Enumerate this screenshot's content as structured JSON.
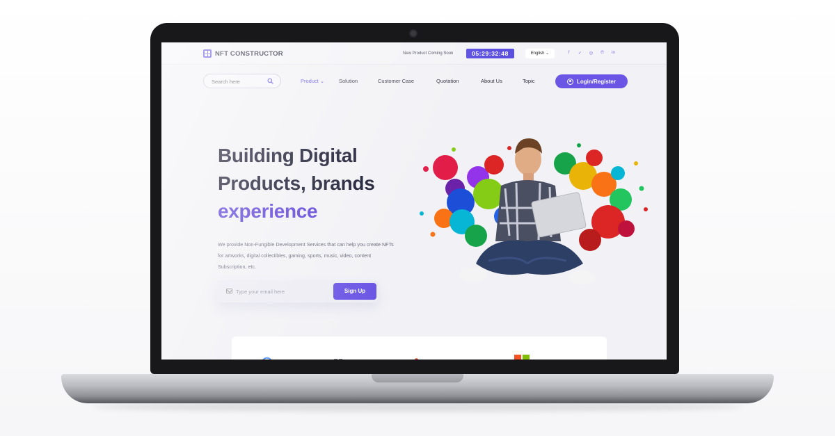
{
  "topbar": {
    "logo_text": "NFT CONSTRUCTOR",
    "coming_soon": "New Product Coming Soon",
    "countdown": "05:29:32:48",
    "language": "English ⌄",
    "social": [
      {
        "name": "facebook-icon",
        "glyph": "f"
      },
      {
        "name": "twitter-icon",
        "glyph": "✓"
      },
      {
        "name": "instagram-icon",
        "glyph": "◎"
      },
      {
        "name": "pinterest-icon",
        "glyph": "℗"
      },
      {
        "name": "linkedin-icon",
        "glyph": "in"
      }
    ]
  },
  "nav": {
    "search_placeholder": "Search here",
    "items": [
      {
        "label": "Product ⌄",
        "active": true
      },
      {
        "label": "Solution"
      },
      {
        "label": "Customer Case"
      },
      {
        "label": "Quotation"
      },
      {
        "label": "About Us"
      },
      {
        "label": "Topic"
      }
    ],
    "login_label": "Login/Register"
  },
  "hero": {
    "title_line1": "Building Digital",
    "title_line2": "Products, brands",
    "title_accent": "experience",
    "description": "We provide Non-Fungible Development Services that can help you create NFTs for artworks, digital collectibles, gaming, sports, music, video, content Subscription, etc.",
    "email_placeholder": "Type your email here",
    "signup_label": "Sign Up"
  },
  "colors": {
    "accent": "#5b4fe0",
    "accent_text": "#5b3fd8",
    "button": "#6a55e4"
  }
}
